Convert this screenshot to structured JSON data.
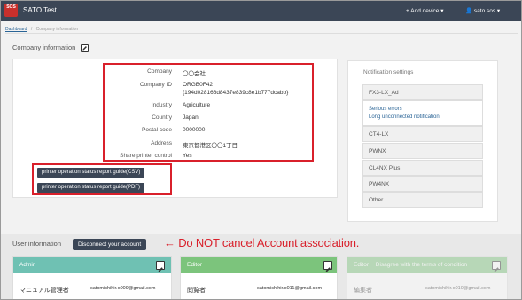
{
  "navbar": {
    "logo_text": "SOS",
    "title": "SATO Test",
    "add_device": "+ Add device ▾",
    "user": "👤 sato sos ▾"
  },
  "breadcrumb": {
    "home": "Dashboard",
    "separator": "/",
    "current": "Company information"
  },
  "company": {
    "section_title": "Company information",
    "rows": [
      {
        "label": "Company",
        "value": "〇〇会社"
      },
      {
        "label": "Company ID",
        "value": "ORGB0F42",
        "value2": "{194d028166d8437e839c8e1b777dcabb}"
      },
      {
        "label": "Industry",
        "value": "Agriculture"
      },
      {
        "label": "Country",
        "value": "Japan"
      },
      {
        "label": "Postal code",
        "value": "0000000"
      },
      {
        "label": "Address",
        "value": "東京都港区〇〇1丁目"
      },
      {
        "label": "Share printer control",
        "value": "Yes"
      }
    ],
    "csv_button": "printer operation status report guide(CSV)",
    "pdf_button": "printer operation status report guide(PDF)"
  },
  "notifications": {
    "title": "Notification settings",
    "items": [
      "FX3-LX_Ad",
      "CT4-LX",
      "PWNX",
      "CL4NX Plus",
      "PW4NX",
      "Other"
    ],
    "expanded_links": [
      "Serious errors",
      "Long unconnected notification"
    ]
  },
  "users": {
    "section_title": "User information",
    "disconnect_button": "Disconnect your account",
    "annotation": "← Do NOT cancel Account association.",
    "cards": [
      {
        "role": "Admin",
        "name": "マニュアル管理者",
        "email": "satomichihir.o009@gmail.com",
        "color": "#6fc1b3"
      },
      {
        "role": "Editor",
        "name": "閲覧者",
        "email": "satomichihir.o011@gmail.com",
        "color": "#7cc47c"
      },
      {
        "role": "Editor",
        "note": "Disagree with the terms of condition",
        "name": "編集者",
        "email": "satomichihir.o010@gmail.com",
        "color": "#7cc47c"
      }
    ]
  },
  "colors": {
    "navbar": "#3b4656",
    "highlight": "#d9202b",
    "link": "#2a6496"
  }
}
